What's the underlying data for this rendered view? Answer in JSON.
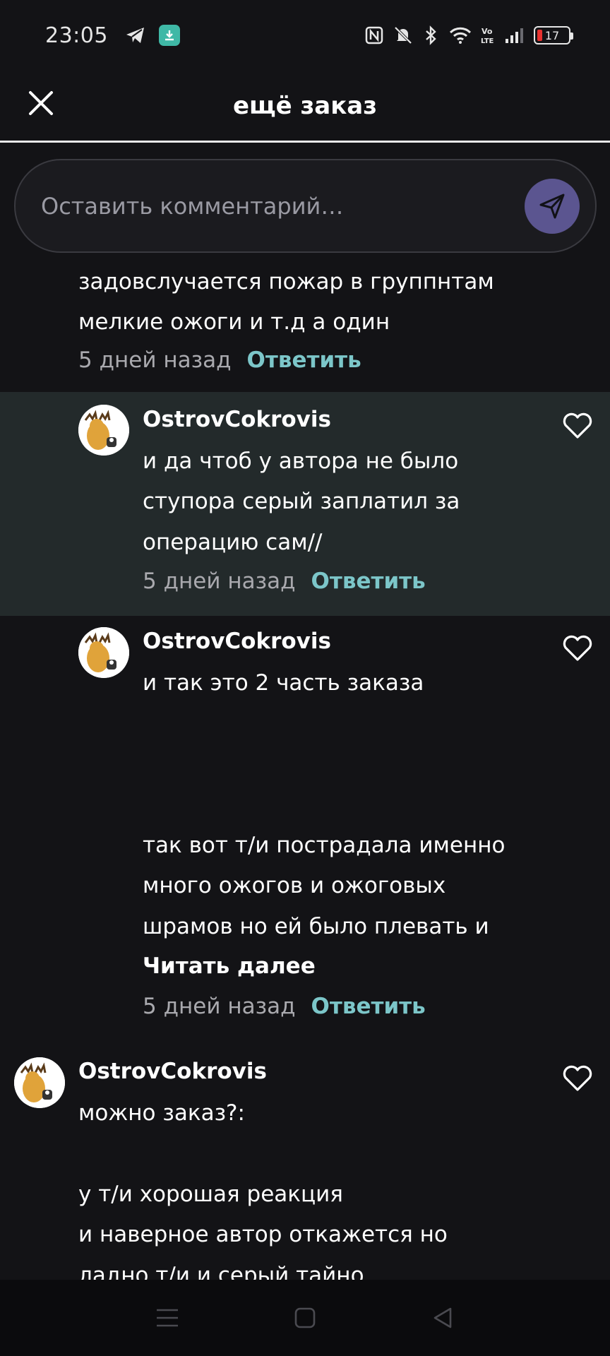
{
  "status_bar": {
    "time": "23:05",
    "battery_level": "17",
    "battery_fraction": 0.17,
    "battery_low_color": "#e8322f",
    "left_icons": [
      "telegram-icon",
      "download-icon"
    ],
    "right_icons": [
      "nfc-icon",
      "mute-icon",
      "bluetooth-icon",
      "wifi-icon",
      "volte-icon",
      "signal-icon",
      "battery-icon"
    ]
  },
  "header": {
    "title": "ещё заказ",
    "close_icon": "close-icon"
  },
  "comment_input": {
    "placeholder": "Оставить комментарий…",
    "value": "",
    "send_icon": "send-icon",
    "send_color": "#5b5590"
  },
  "colors": {
    "background": "#131316",
    "highlight_row": "#232a2b",
    "reply_link": "#7cc6c9",
    "meta_text": "#a9a9ae"
  },
  "comments": [
    {
      "lines": [
        "задовслучается пожар в группнтам",
        "мелкие ожоги и т.д а один"
      ],
      "time": "5 дней назад",
      "reply_label": "Ответить"
    },
    {
      "username": "OstrovCokrovis",
      "lines": [
        "и да чтоб у автора не было",
        "ступора серый заплатил за",
        "операцию сам//"
      ],
      "time": "5 дней назад",
      "reply_label": "Ответить",
      "highlighted": true
    },
    {
      "username": "OstrovCokrovis",
      "lines": [
        "и так это 2 часть заказа",
        "так вот т/и пострадала именно",
        "много ожогов и ожоговых",
        "шрамов но ей было плевать и"
      ],
      "read_more": "Читать далее",
      "time": "5 дней назад",
      "reply_label": "Ответить"
    },
    {
      "username": "OstrovCokrovis",
      "lines": [
        "можно заказ?:",
        "у т/и хорошая реакция",
        "и наверное автор откажется но",
        "ладно т/и и серый тайно"
      ]
    }
  ],
  "nav_bar": {
    "icons": [
      "menu-icon",
      "home-icon",
      "back-icon"
    ]
  }
}
